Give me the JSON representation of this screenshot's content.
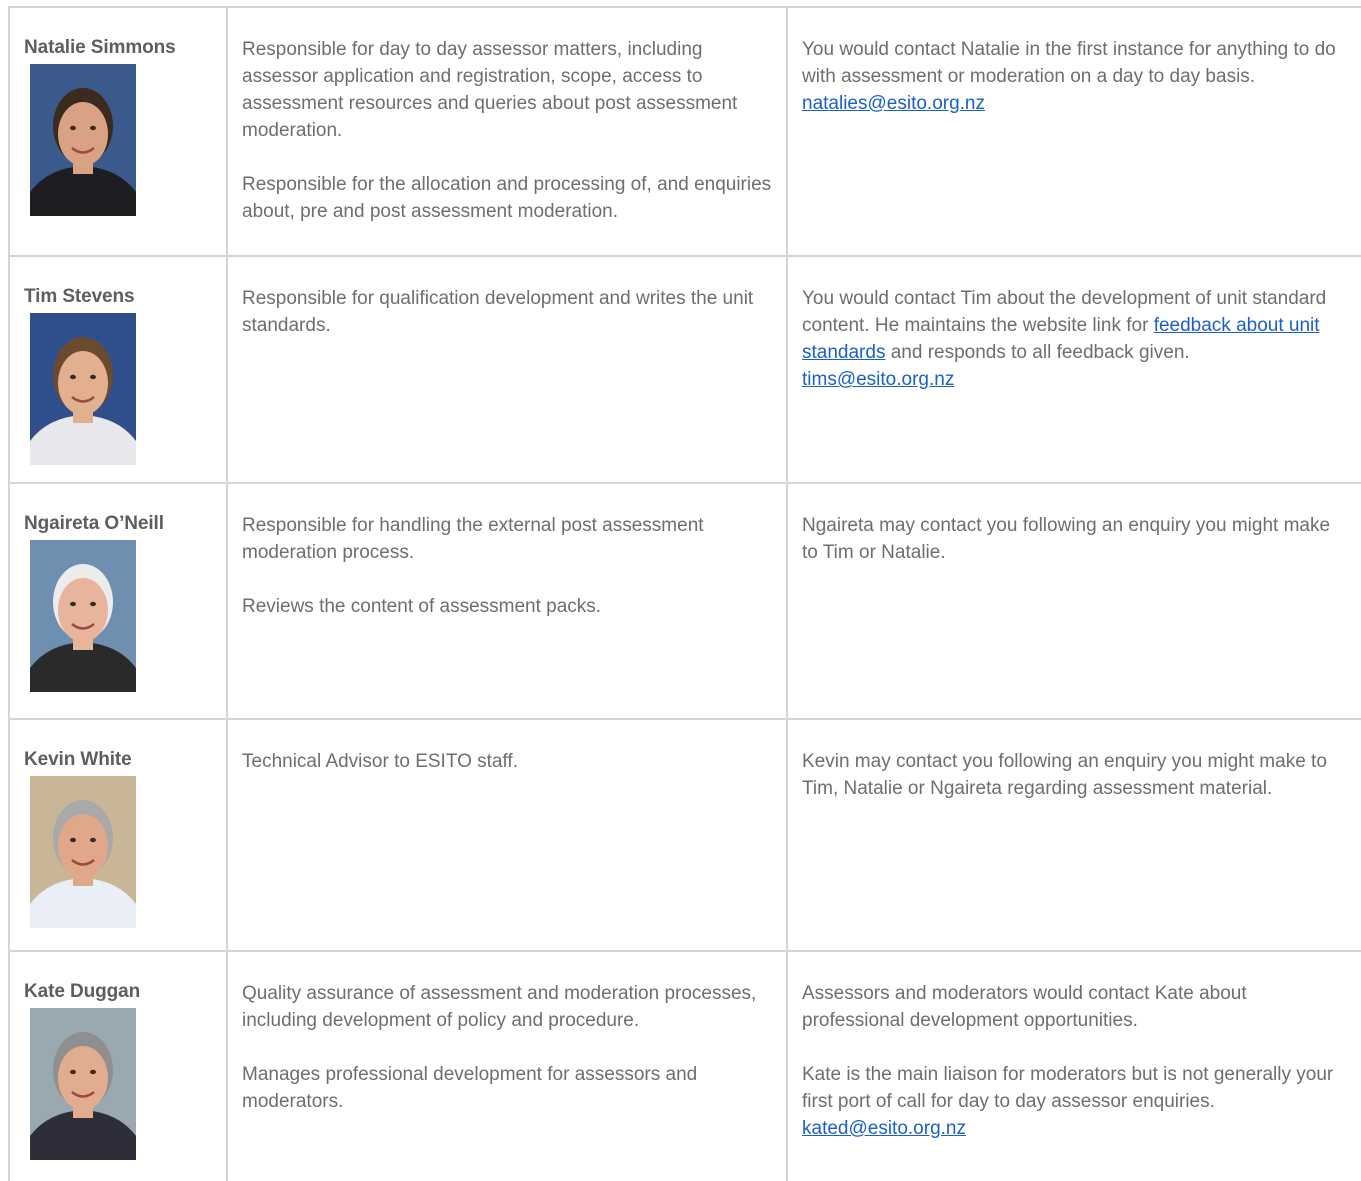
{
  "staff": [
    {
      "name": "Natalie Simmons",
      "role": [
        "Responsible for day to day assessor matters, including assessor application and registration, scope, access to assessment resources and queries about post assessment moderation.",
        "Responsible for the allocation and processing of, and enquiries about, pre and post assessment moderation."
      ],
      "contact_text": "You would contact Natalie in the first instance for anything to do with assessment or moderation on a day to day basis.",
      "email": "natalies@esito.org.nz",
      "photo": {
        "bg": "#3a5a8c",
        "skin": "#d9a383",
        "hair": "#3b2a1e",
        "shirt": "#1d1d22"
      }
    },
    {
      "name": "Tim Stevens",
      "role": [
        "Responsible for qualification development and writes the unit standards."
      ],
      "contact_pre": "You would contact Tim about the development of unit standard content. He maintains the website link for",
      "contact_link": "feedback about unit standards",
      "contact_post": "and responds to all feedback given.",
      "email": "tims@esito.org.nz",
      "photo": {
        "bg": "#2f4f8c",
        "skin": "#e2b08e",
        "hair": "#6a4b30",
        "shirt": "#e8e8ec"
      }
    },
    {
      "name": "Ngaireta O’Neill",
      "role": [
        "Responsible for handling the external post assessment moderation process.",
        "Reviews the content of assessment packs."
      ],
      "contact_text": "Ngaireta may contact you following an enquiry you might make to Tim or Natalie.",
      "photo": {
        "bg": "#6f8fb0",
        "skin": "#e9b49c",
        "hair": "#ececec",
        "shirt": "#2a2a2a"
      }
    },
    {
      "name": "Kevin White",
      "role": [
        "Technical Advisor to ESITO staff."
      ],
      "contact_text": "Kevin may contact you following an enquiry you might make to Tim, Natalie or Ngaireta regarding assessment material.",
      "photo": {
        "bg": "#c9b697",
        "skin": "#e0a888",
        "hair": "#a9a9a9",
        "shirt": "#e9eef7"
      }
    },
    {
      "name": "Kate Duggan",
      "role": [
        "Quality assurance of assessment and moderation processes, including development of policy and procedure.",
        "Manages professional development for assessors and moderators."
      ],
      "contact_paras": [
        "Assessors and moderators would contact Kate about professional development opportunities.",
        "Kate is the main liaison for moderators but is not generally your first port of call for day to day assessor enquiries."
      ],
      "email": "kated@esito.org.nz",
      "photo": {
        "bg": "#9aa8b2",
        "skin": "#e2ac8e",
        "hair": "#8f8f8f",
        "shirt": "#2e2e3a"
      }
    }
  ]
}
